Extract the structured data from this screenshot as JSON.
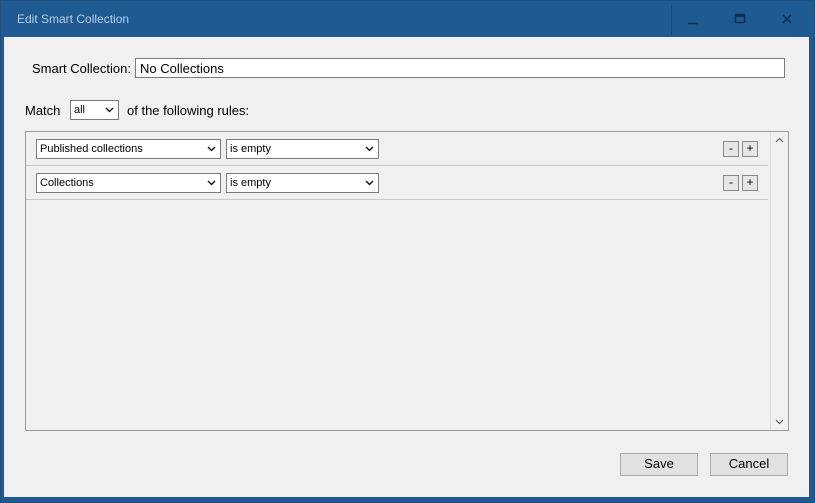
{
  "window": {
    "title": "Edit Smart Collection"
  },
  "form": {
    "name_label": "Smart Collection:",
    "name_value": "No Collections",
    "match_prefix": "Match",
    "match_value": "all",
    "match_suffix": "of the following rules:"
  },
  "rules": [
    {
      "field": "Published collections",
      "operator": "is empty",
      "remove_label": "-",
      "add_label": "+"
    },
    {
      "field": "Collections",
      "operator": "is empty",
      "remove_label": "-",
      "add_label": "+"
    }
  ],
  "footer": {
    "save_label": "Save",
    "cancel_label": "Cancel"
  },
  "colors": {
    "titlebar": "#1f5a92",
    "client_bg": "#f0f0f0",
    "title_text": "#b9cde0"
  }
}
